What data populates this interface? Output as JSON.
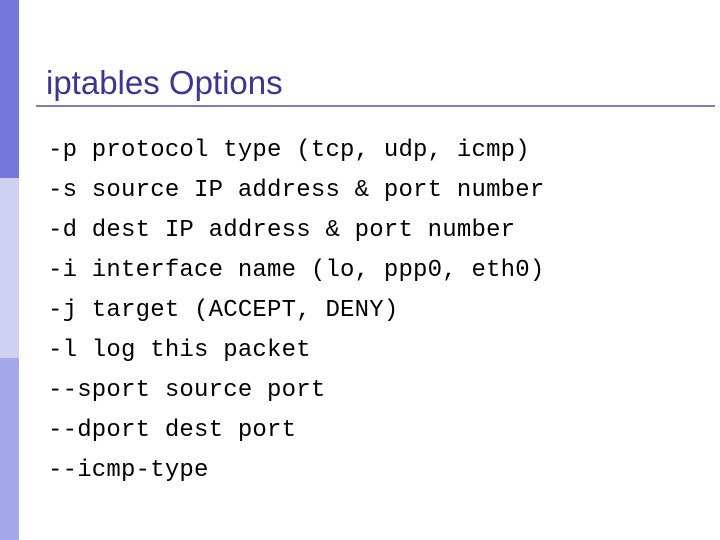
{
  "slide": {
    "title": "iptables Options",
    "background_color": "#ffffff"
  },
  "theme": {
    "title_color": "#3b3595",
    "rule_color": "#7b7eb8",
    "body_text_color": "#000000",
    "sidebar_band_top_color": "#7476dc",
    "sidebar_band_middle_color": "#d0d1f0",
    "sidebar_band_bottom_color": "#a5a8e8"
  },
  "options": [
    {
      "flag": "-p",
      "text": "-p protocol type (tcp, udp, icmp)"
    },
    {
      "flag": "-s",
      "text": "-s source IP address & port number"
    },
    {
      "flag": "-d",
      "text": "-d dest IP address & port number"
    },
    {
      "flag": "-i",
      "text": "-i interface name (lo, ppp0, eth0)"
    },
    {
      "flag": "-j",
      "text": "-j target (ACCEPT, DENY)"
    },
    {
      "flag": "-l",
      "text": "-l log this packet"
    },
    {
      "flag": "--sport",
      "text": "--sport source port"
    },
    {
      "flag": "--dport",
      "text": "--dport dest port"
    },
    {
      "flag": "--icmp-type",
      "text": "--icmp-type"
    }
  ]
}
